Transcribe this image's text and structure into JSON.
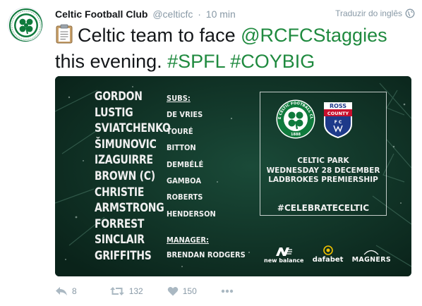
{
  "tweet": {
    "author_name": "Celtic Football Club",
    "handle": "@celticfc",
    "separator": "·",
    "time": "10 min",
    "translate_label": "Traduzir do inglês",
    "text_part1": "Celtic team to face",
    "mention": "@RCFCStaggies",
    "text_part2": "this evening.",
    "hashtag1": "#SPFL",
    "hashtag2": "#COYBIG"
  },
  "lineup": {
    "players": [
      "GORDON",
      "LUSTIG",
      "SVIATCHENKO",
      "ŠIMUNOVIC",
      "IZAGUIRRE",
      "BROWN (C)",
      "CHRISTIE",
      "ARMSTRONG",
      "FORREST",
      "SINCLAIR",
      "GRIFFITHS"
    ],
    "subs_heading": "SUBS:",
    "subs": [
      "DE VRIES",
      "TOURÉ",
      "BITTON",
      "DEMBÉLÉ",
      "GAMBOA",
      "ROBERTS",
      "HENDERSON"
    ],
    "manager_heading": "MANAGER:",
    "manager": "BRENDAN RODGERS"
  },
  "match": {
    "home_crest_text": "THE CELTIC FOOTBALL CLUB",
    "home_crest_year": "1888",
    "away_crest_top": "ROSS",
    "away_crest_mid": "COUNTY",
    "away_crest_fc": "F  C",
    "venue": "CELTIC PARK",
    "date": "WEDNESDAY 28 DECEMBER",
    "competition": "LADBROKES PREMIERSHIP",
    "hashtag": "#CELEBRATECELTIC"
  },
  "sponsors": {
    "newbalance": "new balance",
    "dafabet": "dafabet",
    "magners": "MAGNERS"
  },
  "actions": {
    "reply_count": "8",
    "retweet_count": "132",
    "like_count": "150"
  },
  "colors": {
    "accent_green": "#1f8a3f",
    "muted": "#8899a6",
    "media_bg": "#0d2d22"
  }
}
